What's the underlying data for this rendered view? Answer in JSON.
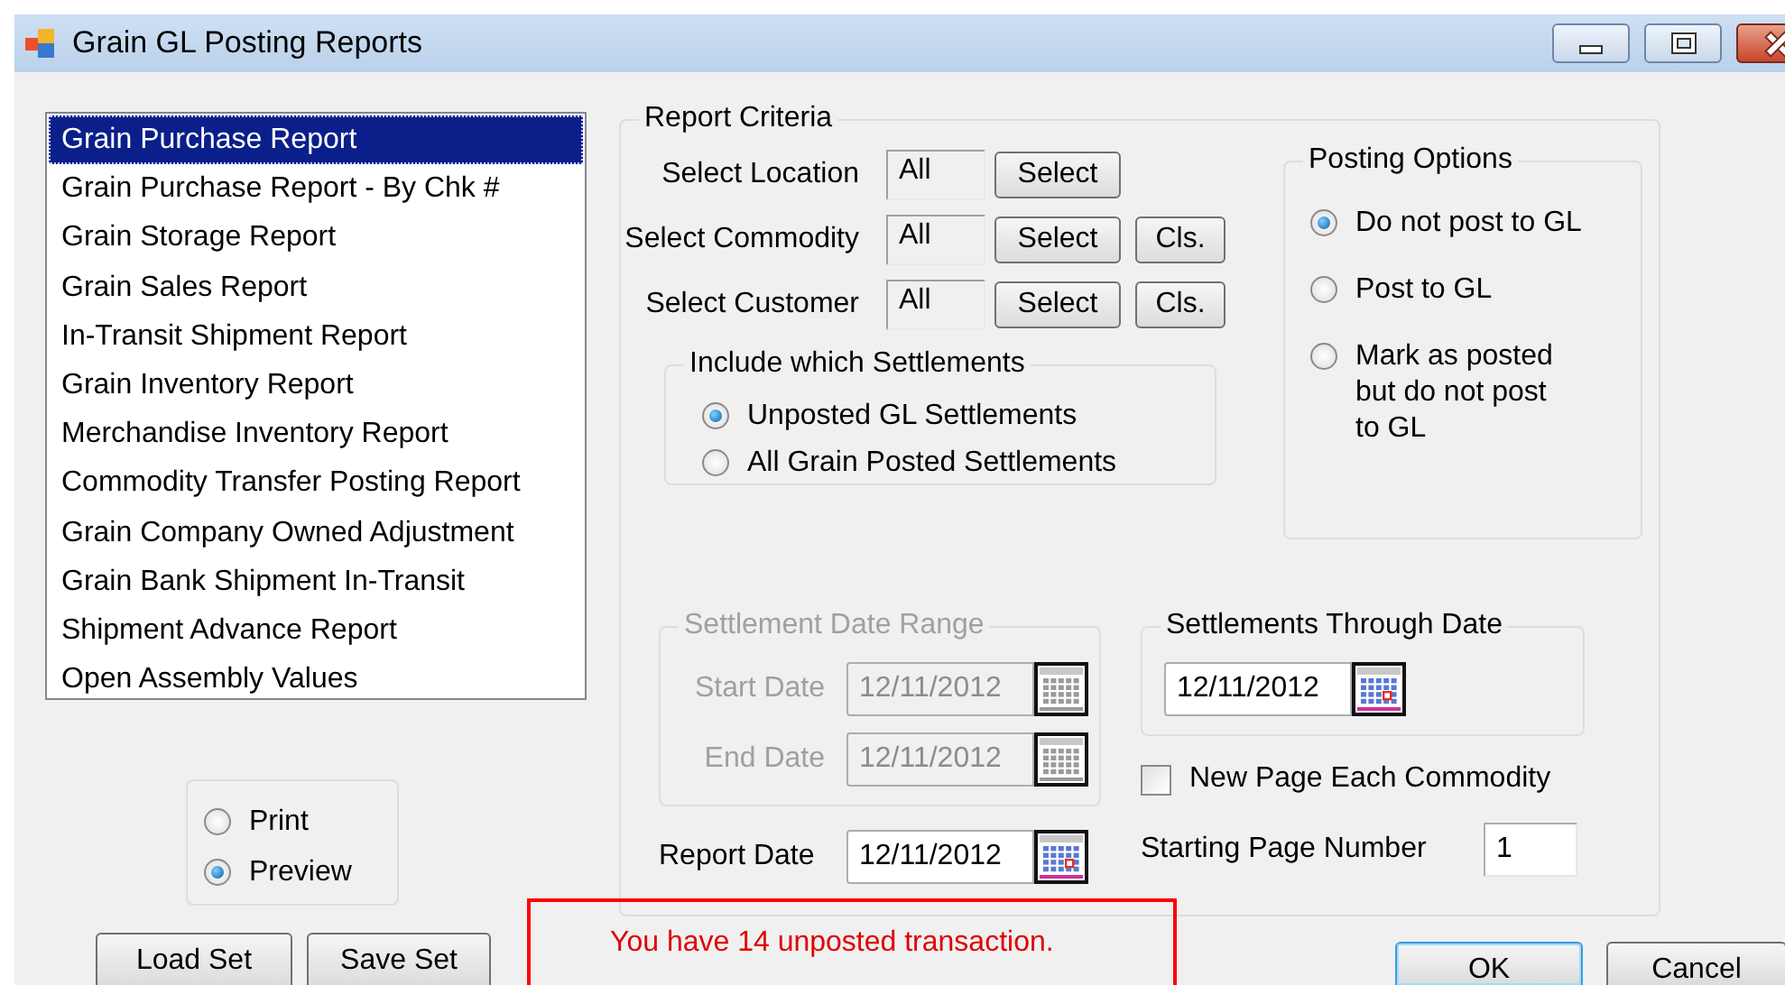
{
  "window": {
    "title": "Grain GL Posting Reports"
  },
  "reports": [
    {
      "label": "Grain Purchase Report",
      "selected": true
    },
    {
      "label": "Grain Purchase Report - By Chk #",
      "selected": false
    },
    {
      "label": "Grain Storage Report",
      "selected": false
    },
    {
      "label": "Grain Sales Report",
      "selected": false
    },
    {
      "label": "In-Transit Shipment Report",
      "selected": false
    },
    {
      "label": "Grain Inventory Report",
      "selected": false
    },
    {
      "label": "Merchandise Inventory Report",
      "selected": false
    },
    {
      "label": "Commodity Transfer Posting Report",
      "selected": false
    },
    {
      "label": "Grain Company Owned Adjustment",
      "selected": false
    },
    {
      "label": "Grain Bank Shipment In-Transit",
      "selected": false
    },
    {
      "label": "Shipment Advance Report",
      "selected": false
    },
    {
      "label": "Open Assembly Values",
      "selected": false
    }
  ],
  "output": [
    {
      "label": "Print",
      "selected": false
    },
    {
      "label": "Preview",
      "selected": true
    }
  ],
  "buttons_left": [
    "Load Set",
    "Save Set"
  ],
  "report_criteria": {
    "title": "Report Criteria",
    "selectors": [
      {
        "label": "Select Location",
        "value": "All",
        "select": "Select"
      },
      {
        "label": "Select Commodity",
        "value": "All",
        "select": "Select",
        "clear": "Cls."
      },
      {
        "label": "Select Customer",
        "value": "All",
        "select": "Select",
        "clear": "Cls."
      }
    ],
    "include_settlements": {
      "title": "Include which Settlements",
      "options": [
        {
          "label": "Unposted GL Settlements",
          "selected": true
        },
        {
          "label": "All Grain Posted Settlements",
          "selected": false
        }
      ]
    },
    "posting_options": {
      "title": "Posting Options",
      "options": [
        {
          "label": "Do not post to GL",
          "selected": true
        },
        {
          "label": "Post to GL",
          "selected": false
        },
        {
          "label": "Mark as posted but do not post to GL",
          "selected": false
        }
      ]
    },
    "settlement_date_range": {
      "title": "Settlement Date Range",
      "disabled": true,
      "fields": [
        {
          "label": "Start Date",
          "value": "12/11/2012"
        },
        {
          "label": "End Date",
          "value": "12/11/2012"
        }
      ]
    },
    "settlements_through_date": {
      "title": "Settlements Through Date",
      "value": "12/11/2012"
    },
    "new_page_each_commodity": {
      "label": "New Page Each Commodity",
      "checked": false
    },
    "report_date": {
      "label": "Report Date",
      "value": "12/11/2012"
    },
    "starting_page_number": {
      "label": "Starting Page Number",
      "value": "1"
    }
  },
  "warning": {
    "text": "You have 14 unposted transaction."
  },
  "buttons_right": [
    "OK",
    "Cancel"
  ]
}
